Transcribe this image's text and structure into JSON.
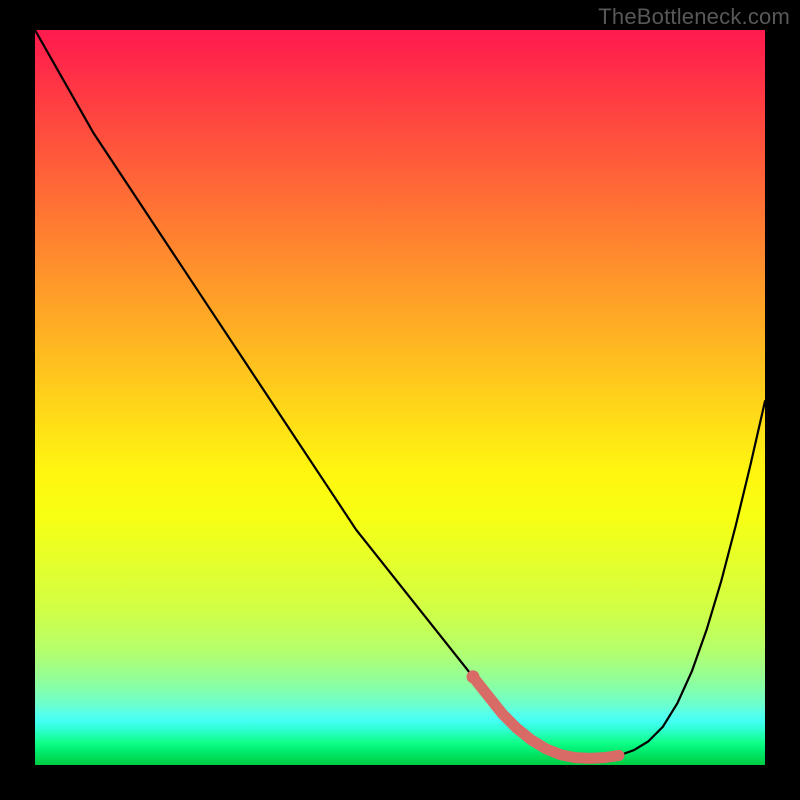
{
  "watermark": "TheBottleneck.com",
  "colors": {
    "background_frame": "#000000",
    "curve": "#000000",
    "highlight": "#d96b66",
    "watermark": "#58585a",
    "gradient_top": "#ff1a4e",
    "gradient_mid": "#fff012",
    "gradient_bottom": "#00cc40"
  },
  "chart_data": {
    "type": "line",
    "title": "",
    "xlabel": "",
    "ylabel": "",
    "xlim": [
      0,
      100
    ],
    "ylim": [
      0,
      100
    ],
    "x": [
      0,
      4,
      8,
      12,
      16,
      20,
      24,
      28,
      32,
      36,
      40,
      44,
      48,
      52,
      56,
      60,
      62,
      64,
      66,
      68,
      70,
      72,
      74,
      76,
      78,
      80,
      82,
      84,
      86,
      88,
      90,
      92,
      94,
      96,
      98,
      100
    ],
    "y": [
      100,
      93,
      86,
      80,
      74,
      68,
      62,
      56,
      50,
      44,
      38,
      32,
      27,
      22,
      17,
      12,
      9.5,
      7,
      5,
      3.4,
      2.2,
      1.4,
      1.0,
      0.9,
      1.0,
      1.3,
      2.0,
      3.2,
      5.2,
      8.4,
      12.8,
      18.4,
      25.0,
      32.6,
      40.8,
      49.5
    ],
    "highlight_range_x": [
      60,
      80
    ],
    "highlight_range_y": [
      12,
      1.3
    ],
    "annotations": []
  }
}
